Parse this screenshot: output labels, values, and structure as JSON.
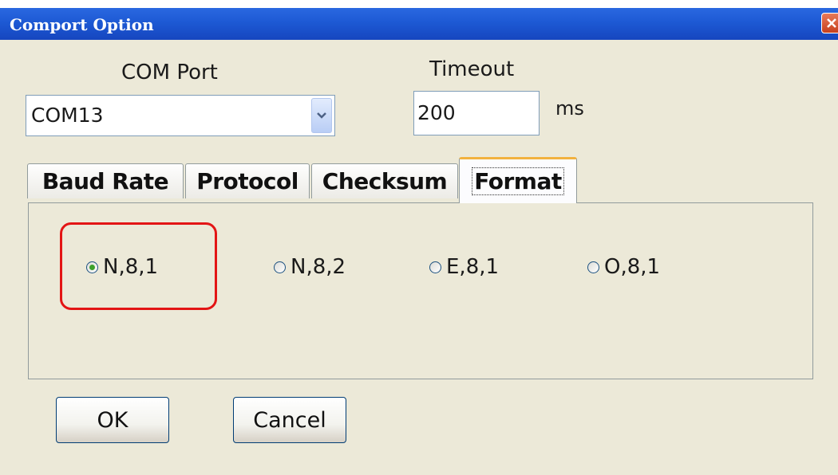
{
  "window": {
    "title": "Comport Option"
  },
  "com_port": {
    "label": "COM Port",
    "value": "COM13"
  },
  "timeout": {
    "label": "Timeout",
    "value": "200",
    "unit": "ms"
  },
  "tabs": [
    {
      "label": "Baud Rate",
      "active": false
    },
    {
      "label": "Protocol",
      "active": false
    },
    {
      "label": "Checksum",
      "active": false
    },
    {
      "label": "Format",
      "active": true
    }
  ],
  "format_options": [
    {
      "label": "N,8,1",
      "checked": true
    },
    {
      "label": "N,8,2",
      "checked": false
    },
    {
      "label": "E,8,1",
      "checked": false
    },
    {
      "label": "O,8,1",
      "checked": false
    }
  ],
  "buttons": {
    "ok_label": "OK",
    "cancel_label": "Cancel"
  },
  "colors": {
    "titlebar": "#1d59d4",
    "highlight": "#e31515",
    "radio_dot": "#3da12c",
    "active_tab_accent": "#f2b23f"
  }
}
